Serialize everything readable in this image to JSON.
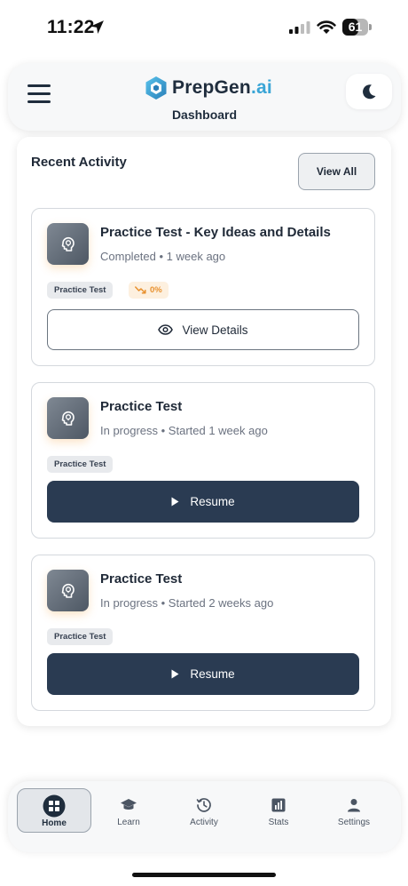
{
  "status_bar": {
    "time": "11:22",
    "battery": "61",
    "battery_pct": 61
  },
  "header": {
    "logo_main": "PrepGen",
    "logo_suffix": ".ai",
    "page_title": "Dashboard",
    "menu_icon": "hamburger-menu-icon",
    "theme_icon": "moon-icon"
  },
  "recent_activity": {
    "title": "Recent Activity",
    "view_all_label": "View All",
    "items": [
      {
        "title": "Practice Test - Key Ideas and Details",
        "status": "Completed • 1 week ago",
        "tag": "Practice Test",
        "score": "0%",
        "action_label": "View Details",
        "action_icon": "eye-icon"
      },
      {
        "title": "Practice Test",
        "status": "In progress • Started 1 week ago",
        "tag": "Practice Test",
        "action_label": "Resume",
        "action_icon": "play-icon"
      },
      {
        "title": "Practice Test",
        "status": "In progress • Started 2 weeks ago",
        "tag": "Practice Test",
        "action_label": "Resume",
        "action_icon": "play-icon"
      }
    ]
  },
  "bottom_nav": {
    "items": [
      {
        "label": "Home",
        "icon": "home-grid-icon",
        "active": true
      },
      {
        "label": "Learn",
        "icon": "graduation-cap-icon",
        "active": false
      },
      {
        "label": "Activity",
        "icon": "history-icon",
        "active": false
      },
      {
        "label": "Stats",
        "icon": "bar-chart-icon",
        "active": false
      },
      {
        "label": "Settings",
        "icon": "user-icon",
        "active": false
      }
    ]
  },
  "colors": {
    "primary": "#2a3b52",
    "accent": "#3aa5d6",
    "score_warning": "#e8912f"
  }
}
